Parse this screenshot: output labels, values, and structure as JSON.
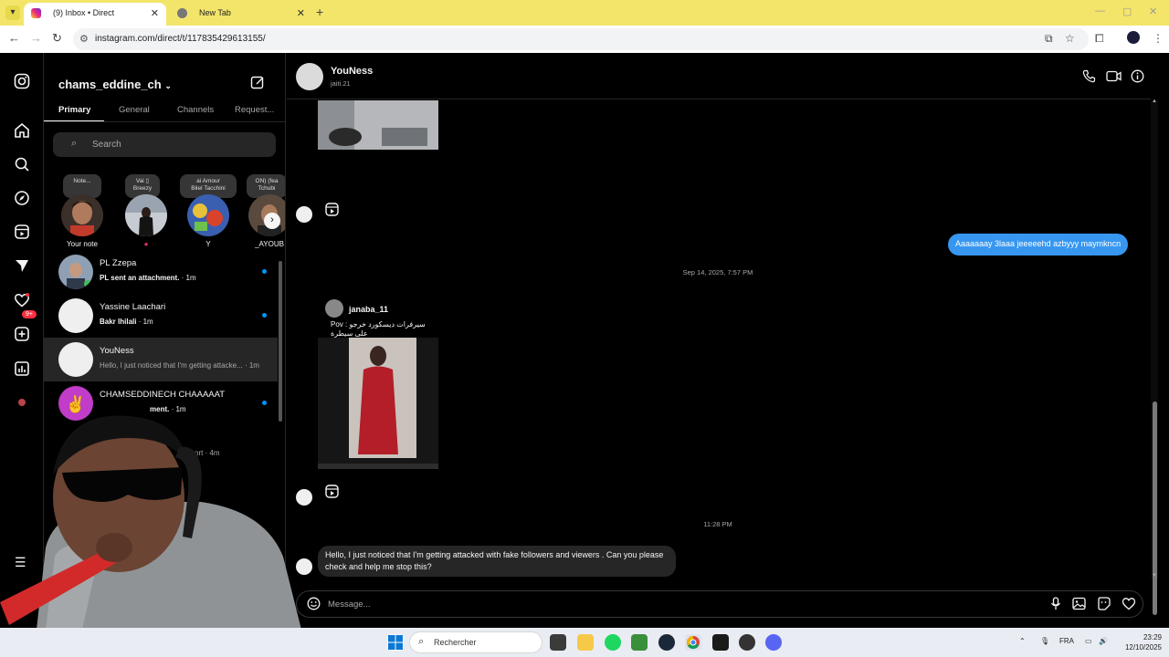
{
  "browser": {
    "tabs": [
      {
        "title": "(9) Inbox • Direct",
        "active": true
      },
      {
        "title": "New Tab",
        "active": false
      }
    ],
    "url": "instagram.com/direct/t/117835429613155/"
  },
  "inbox": {
    "username": "chams_eddine_ch",
    "tabs": [
      "Primary",
      "General",
      "Channels",
      "Request..."
    ],
    "search_placeholder": "Search",
    "notes": [
      {
        "bubble": "Note...",
        "name": "Your note"
      },
      {
        "bubble": "Vai ▯\nBreezy",
        "name": ""
      },
      {
        "bubble": "ai Amour\nBilel Tacchini",
        "name": "Y"
      },
      {
        "bubble": "ON) (fea\nTchubi",
        "name": "_AYOUB"
      }
    ],
    "conversations": [
      {
        "name": "PL Zzepa",
        "preview": "PL sent an attachment.",
        "time": "1m",
        "unread": true
      },
      {
        "name": "Yassine Laachari",
        "preview": "Bakr lhilali",
        "time": "1m",
        "unread": true
      },
      {
        "name": "YouNess",
        "preview": "Hello, I just noticed that I'm getting attacke...",
        "time": "1m",
        "unread": false,
        "selected": true
      },
      {
        "name": "CHAMSEDDINECH CHAAAAAT",
        "preview": "ment.",
        "time": "1m",
        "unread": true
      },
      {
        "name": "",
        "preview": "ort",
        "time": "4m",
        "unread": false
      }
    ],
    "notification_count": "9+"
  },
  "chat": {
    "name": "YouNess",
    "handle": "jaiti.21",
    "outgoing_message": "Aaaaaaay 3laaa jeeeeehd azbyyy maymkncn",
    "timestamp_1": "Sep 14, 2025, 7:57 PM",
    "shared_post_author": "janaba_11",
    "shared_post_caption": "Pov : سيرفرات ديسكورد خرجو على سيطرة",
    "timestamp_2": "11:28 PM",
    "incoming_message": "Hello, I just noticed that I'm getting attacked with fake followers and viewers . Can you please check and help me stop this?",
    "composer_placeholder": "Message..."
  },
  "taskbar": {
    "search_placeholder": "Rechercher",
    "language": "FRA",
    "time": "23:29",
    "date": "12/10/2025",
    "colors": {
      "accent": "#3797f0",
      "unread_dot": "#0095f6",
      "badge": "#ff3040"
    }
  }
}
